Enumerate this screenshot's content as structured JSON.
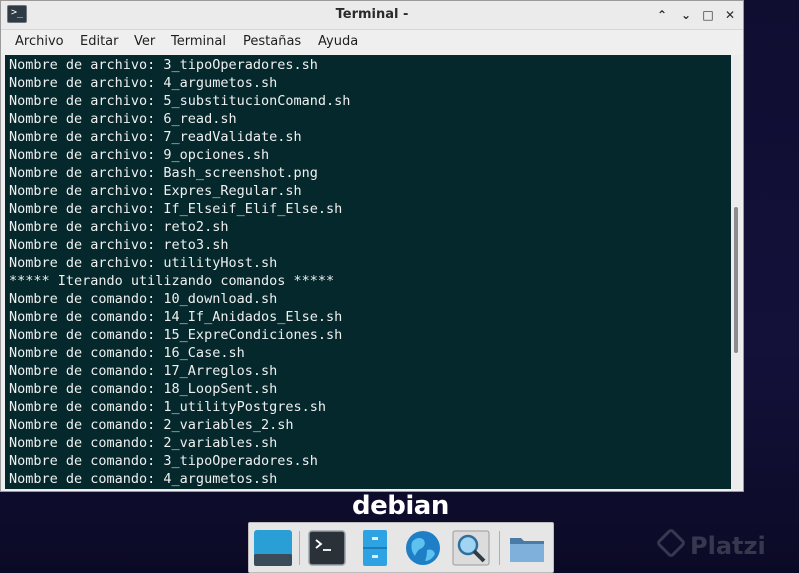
{
  "window": {
    "title": "Terminal -",
    "app_icon_glyph": ">_",
    "controls": {
      "minimize": "⌃",
      "restore": "⌄",
      "maximize": "□",
      "close": "✕"
    }
  },
  "menu": [
    "Archivo",
    "Editar",
    "Ver",
    "Terminal",
    "Pestañas",
    "Ayuda"
  ],
  "terminal": {
    "background": "#04282c",
    "foreground": "#f0f0f0",
    "lines": [
      "Nombre de archivo: 3_tipoOperadores.sh",
      "Nombre de archivo: 4_argumetos.sh",
      "Nombre de archivo: 5_substitucionComand.sh",
      "Nombre de archivo: 6_read.sh",
      "Nombre de archivo: 7_readValidate.sh",
      "Nombre de archivo: 9_opciones.sh",
      "Nombre de archivo: Bash_screenshot.png",
      "Nombre de archivo: Expres_Regular.sh",
      "Nombre de archivo: If_Elseif_Elif_Else.sh",
      "Nombre de archivo: reto2.sh",
      "Nombre de archivo: reto3.sh",
      "Nombre de archivo: utilityHost.sh",
      "***** Iterando utilizando comandos *****",
      "Nombre de comando: 10_download.sh",
      "Nombre de comando: 14_If_Anidados_Else.sh",
      "Nombre de comando: 15_ExpreCondiciones.sh",
      "Nombre de comando: 16_Case.sh",
      "Nombre de comando: 17_Arreglos.sh",
      "Nombre de comando: 18_LoopSent.sh",
      "Nombre de comando: 1_utilityPostgres.sh",
      "Nombre de comando: 2_variables_2.sh",
      "Nombre de comando: 2_variables.sh",
      "Nombre de comando: 3_tipoOperadores.sh",
      "Nombre de comando: 4_argumetos.sh"
    ]
  },
  "desktop": {
    "brand": "debian",
    "brand_color": "#d70751",
    "watermark": "Platzi"
  },
  "dock": {
    "items": [
      {
        "name": "show-desktop",
        "icon": "desktop-icon"
      },
      {
        "name": "terminal",
        "icon": "terminal-icon"
      },
      {
        "name": "file-manager",
        "icon": "cabinet-icon"
      },
      {
        "name": "web-browser",
        "icon": "globe-icon"
      },
      {
        "name": "app-finder",
        "icon": "magnifier-icon"
      },
      {
        "name": "home-folder",
        "icon": "folder-icon"
      }
    ]
  }
}
